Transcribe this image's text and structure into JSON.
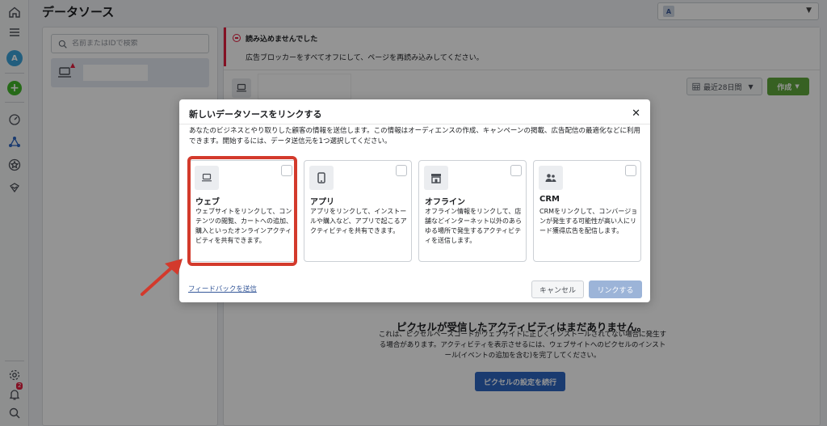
{
  "header": {
    "title": "データソース",
    "account_initial": "A"
  },
  "rail": {
    "avatar_initial": "A",
    "notification_count": "2"
  },
  "left_panel": {
    "search_placeholder": "名前またはIDで検索"
  },
  "error_banner": {
    "title": "読み込めませんでした",
    "message": "広告ブロッカーをすべてオフにして、ページを再読み込みしてください。"
  },
  "toolbar": {
    "date_range": "最近28日間",
    "create_label": "作成"
  },
  "empty_state": {
    "title": "ピクセルが受信したアクティビティはまだありません。",
    "body": "これは、ピクセルベースコードがウェブサイトに正しくインストールされてない場合に発生する場合があります。アクティビティを表示させるには、ウェブサイトへのピクセルのインストール(イベントの追加を含む)を完了してください。",
    "button": "ピクセルの設定を続行"
  },
  "modal": {
    "title": "新しいデータソースをリンクする",
    "close": "✕",
    "description": "あなたのビジネスとやり取りした顧客の情報を送信します。この情報はオーディエンスの作成、キャンペーンの掲載、広告配信の最適化などに利用できます。開始するには、データ送信元を1つ選択してください。",
    "cards": [
      {
        "title": "ウェブ",
        "description": "ウェブサイトをリンクして、コンテンツの閲覧、カートへの追加、購入といったオンラインアクティビティを共有できます。"
      },
      {
        "title": "アプリ",
        "description": "アプリをリンクして、インストールや購入など、アプリで起こるアクティビティを共有できます。"
      },
      {
        "title": "オフライン",
        "description": "オフライン情報をリンクして、店舗などインターネット以外のあらゆる場所で発生するアクティビティを送信します。"
      },
      {
        "title": "CRM",
        "description": "CRMをリンクして、コンバージョンが発生する可能性が高い人にリード獲得広告を配信します。"
      }
    ],
    "feedback_link": "フィードバックを送信",
    "cancel_label": "キャンセル",
    "link_label": "リンクする"
  },
  "colors": {
    "highlight": "#d33a2c",
    "primary_disabled": "#9cb4d8",
    "create_green": "#5fa83b",
    "error_red": "#e41e3f"
  }
}
